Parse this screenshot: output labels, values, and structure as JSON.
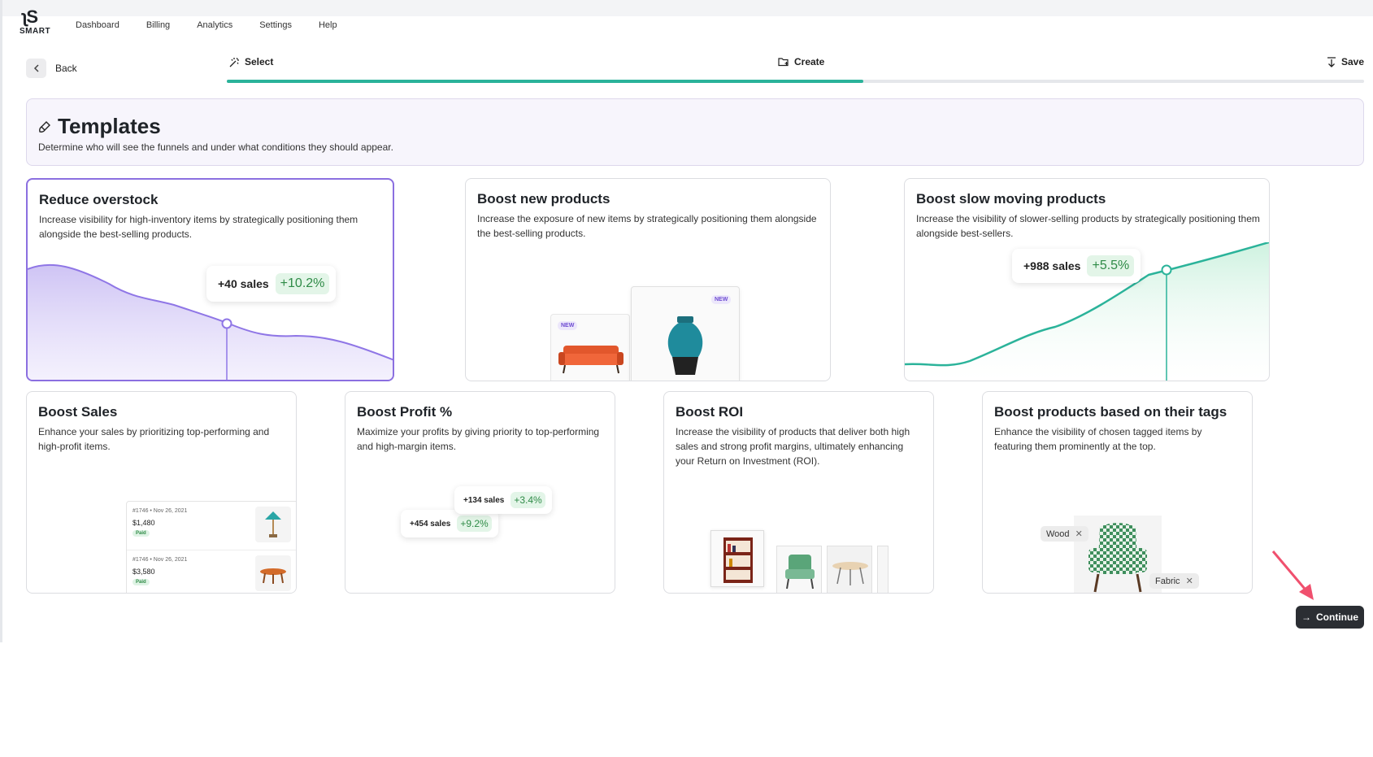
{
  "nav": {
    "logo_word": "SMART",
    "links": [
      "Dashboard",
      "Billing",
      "Analytics",
      "Settings",
      "Help"
    ]
  },
  "back_label": "Back",
  "steps": [
    {
      "label": "Select",
      "icon": "wand-icon"
    },
    {
      "label": "Create",
      "icon": "folder-plus-icon"
    },
    {
      "label": "Save",
      "icon": "download-icon"
    }
  ],
  "progress_fraction": 0.56,
  "banner": {
    "title": "Templates",
    "description": "Determine who will see the funnels and under what conditions they should appear."
  },
  "cards": [
    {
      "title": "Reduce overstock",
      "description": "Increase visibility for high-inventory items by strategically positioning them alongside the best-selling products.",
      "stat_sales": "+40 sales",
      "stat_pct": "+10.2%",
      "selected": true
    },
    {
      "title": "Boost new products",
      "description": "Increase the exposure of new items by strategically positioning them alongside the best-selling products.",
      "badge": "NEW"
    },
    {
      "title": "Boost slow moving products",
      "description": "Increase the visibility of slower-selling products by strategically positioning them alongside best-sellers.",
      "stat_sales": "+988 sales",
      "stat_pct": "+5.5%"
    },
    {
      "title": "Boost Sales",
      "description": "Enhance your sales by prioritizing top-performing and high-profit items.",
      "orders": [
        {
          "id": "#1746 • Nov 26, 2021",
          "amount": "$1,480",
          "status": "Paid"
        },
        {
          "id": "#1746 • Nov 26, 2021",
          "amount": "$3,580",
          "status": "Paid"
        }
      ]
    },
    {
      "title": "Boost Profit %",
      "description": "Maximize your profits by giving priority to top-performing and high-margin items.",
      "stat_a_sales": "+134 sales",
      "stat_a_pct": "+3.4%",
      "stat_b_sales": "+454 sales",
      "stat_b_pct": "+9.2%"
    },
    {
      "title": "Boost ROI",
      "description": "Increase the visibility of products that deliver both high sales and strong profit margins, ultimately enhancing your Return on Investment (ROI)."
    },
    {
      "title": "Boost products based on their tags",
      "description": "Enhance the visibility of chosen tagged items by featuring them prominently at the top.",
      "tags": [
        "Wood",
        "Fabric"
      ]
    }
  ],
  "continue_label": "Continue",
  "colors": {
    "accent": "#2bb39a",
    "selected_border": "#8b6fe0",
    "dark_button": "#2b2e33",
    "annotation_arrow": "#f0506e"
  }
}
